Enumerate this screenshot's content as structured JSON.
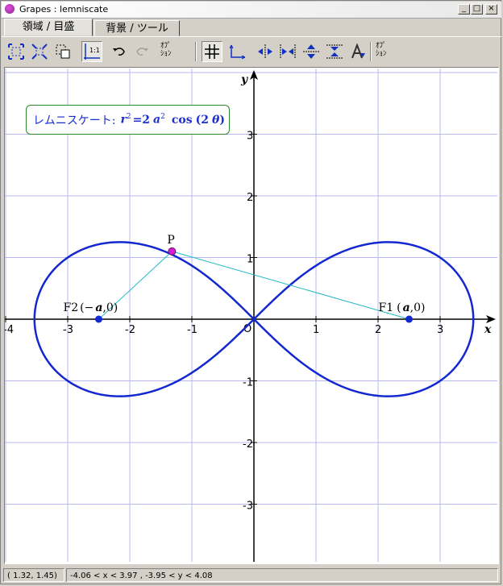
{
  "window": {
    "title": "Grapes : lemniscate"
  },
  "title_buttons": {
    "minimize": "_",
    "maximize": "□",
    "close": "×"
  },
  "tabs": [
    {
      "label": "領域 / 目盛"
    },
    {
      "label": "背景 / ツール"
    }
  ],
  "toolbar": {
    "option_label_1a": "ｵﾌﾟ",
    "option_label_1b": "ｼｮﾝ",
    "option_label_2a": "ｵﾌﾟ",
    "option_label_2b": "ｼｮﾝ",
    "scale_label": "1:1"
  },
  "formula": {
    "prefix": "レムニスケート:",
    "r": "r",
    "exp1": "2",
    "eq": "=2",
    "a": "a",
    "exp2": "2",
    "cos": "cos",
    "open": "(2",
    "theta": "θ",
    "close": ")"
  },
  "graph": {
    "x_axis_label": "x",
    "y_axis_label": "y",
    "origin_label": "O",
    "x_ticks": [
      "-4",
      "-3",
      "-2",
      "-1",
      "1",
      "2",
      "3"
    ],
    "y_ticks": [
      "3",
      "2",
      "1",
      "-1",
      "-2",
      "-3"
    ],
    "points": {
      "P": "P",
      "F1": {
        "name": "F1",
        "open": "(",
        "a": "a",
        "rest": ",0)"
      },
      "F2": {
        "name": "F2",
        "open": "(−",
        "a": "a",
        "rest": ",0)"
      }
    },
    "curve_color": "#1428d0",
    "segment_color": "#20b8c8",
    "grid_color": "#b8b8f0",
    "point_P_color": "#d020d0",
    "focus_color": "#1428d0",
    "a_value": 2.5,
    "P_coords": [
      -1.32,
      1.1
    ]
  },
  "status": {
    "cursor": "( 1.32, 1.45)",
    "range": "-4.06 < x <  3.97 , -3.95 < y <  4.08"
  }
}
